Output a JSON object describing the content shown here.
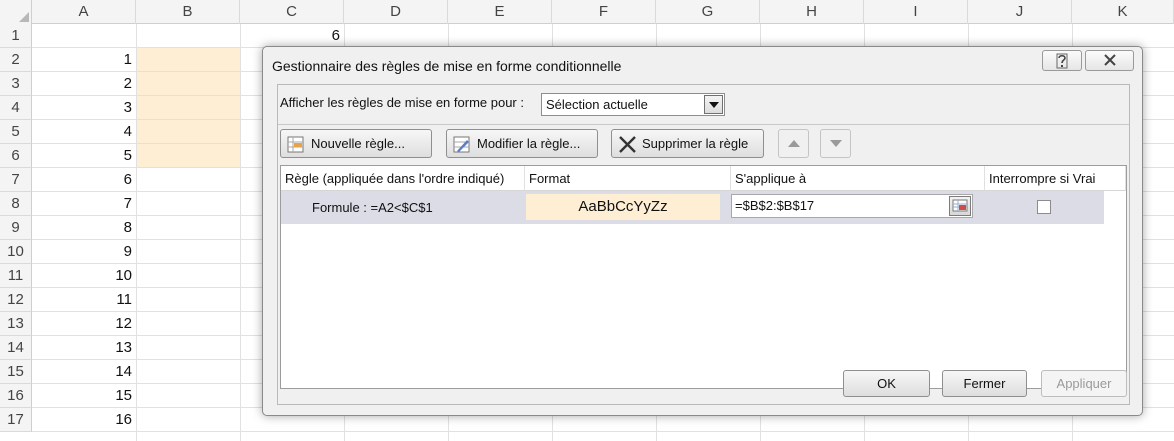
{
  "sheet": {
    "columns": [
      "A",
      "B",
      "C",
      "D",
      "E",
      "F",
      "G",
      "H",
      "I",
      "J",
      "K"
    ],
    "rows": [
      "1",
      "2",
      "3",
      "4",
      "5",
      "6",
      "7",
      "8",
      "9",
      "10",
      "11",
      "12",
      "13",
      "14",
      "15",
      "16",
      "17"
    ],
    "c1_value": "6",
    "a_values": [
      "1",
      "2",
      "3",
      "4",
      "5",
      "6",
      "7",
      "8",
      "9",
      "10",
      "11",
      "12",
      "13",
      "14",
      "15",
      "16"
    ],
    "highlight_color": "#fdeed4"
  },
  "dialog": {
    "title": "Gestionnaire des règles de mise en forme conditionnelle",
    "help_icon": "question-icon",
    "close_icon": "close-icon",
    "show_rules_label": "Afficher les règles de mise en forme pour :",
    "show_rules_value": "Sélection actuelle",
    "toolbar": {
      "new_rule": "Nouvelle règle...",
      "edit_rule": "Modifier la règle...",
      "delete_rule": "Supprimer la règle"
    },
    "table": {
      "headers": {
        "rule": "Règle (appliquée dans l'ordre indiqué)",
        "format": "Format",
        "applies_to": "S'applique à",
        "stop_if_true": "Interrompre si Vrai"
      },
      "rows": [
        {
          "rule": "Formule : =A2<$C$1",
          "format_preview": "AaBbCcYyZz",
          "applies_to": "=$B$2:$B$17",
          "stop_if_true": false
        }
      ]
    },
    "buttons": {
      "ok": "OK",
      "close": "Fermer",
      "apply": "Appliquer"
    }
  }
}
